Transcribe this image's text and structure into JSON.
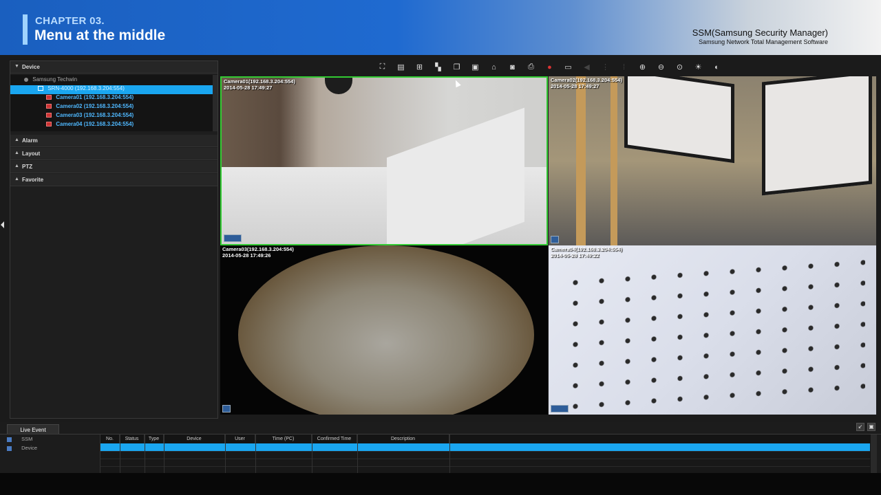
{
  "banner": {
    "chapter": "CHAPTER 03.",
    "title": "Menu at the middle",
    "product": "SSM(Samsung Security Manager)",
    "product_sub": "Samsung Network Total Management Software"
  },
  "sidebar": {
    "sections": [
      "Device",
      "Alarm",
      "Layout",
      "PTZ",
      "Favorite"
    ],
    "tree": {
      "root": "Samsung Techwin",
      "recorder": "SRN-4000 (192.168.3.204:554)",
      "cameras": [
        "Camera01 (192.168.3.204:554)",
        "Camera02 (192.168.3.204:554)",
        "Camera03 (192.168.3.204:554)",
        "Camera04 (192.168.3.204:554)"
      ]
    }
  },
  "toolbar": {
    "icons": [
      "fullscreen-icon",
      "layout-icon",
      "sequence-icon",
      "split-icon",
      "overlay-icon",
      "display-icon",
      "alarm-icon",
      "snapshot-icon",
      "print-icon",
      "record-icon",
      "export-icon",
      "audio-icon",
      "grid-icon",
      "ptz-icon",
      "zoom-in-icon",
      "zoom-out-icon",
      "zoom-fit-icon",
      "brightness-icon",
      "contrast-icon"
    ]
  },
  "tiles": [
    {
      "label": "Camera01(192.168.3.204:554)",
      "time": "2014-05-28 17:49:27"
    },
    {
      "label": "Camera02(192.168.3.204:554)",
      "time": "2014-05-28 17:49:27"
    },
    {
      "label": "Camera03(192.168.3.204:554)",
      "time": "2014-05-28 17:49:26"
    },
    {
      "label": "Camera04(192.168.3.204:554)",
      "time": "2014-05-28 17:49:22"
    }
  ],
  "events": {
    "tab": "Live Event",
    "filters": [
      "SSM",
      "Device"
    ],
    "columns": [
      "No.",
      "Status",
      "Type",
      "Device",
      "User",
      "Time (PC)",
      "Confirmed Time",
      "Description"
    ]
  },
  "colors": {
    "selection": "#1aa6f0",
    "active_tile_border": "#33cc33",
    "banner_blue": "#1f6ad0"
  }
}
